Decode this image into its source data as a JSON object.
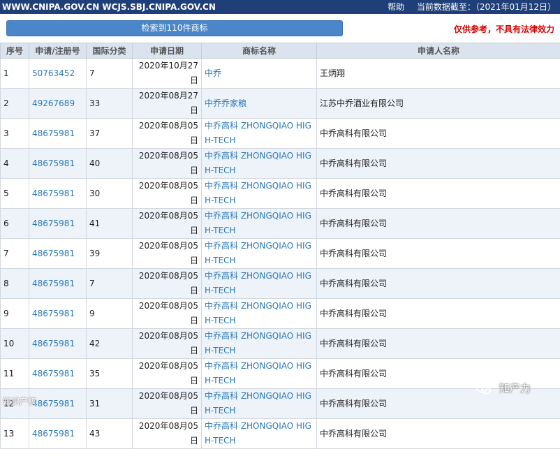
{
  "topbar": {
    "sites": "WWW.CNIPA.GOV.CN WCJS.SBJ.CNIPA.GOV.CN",
    "help": "帮助",
    "data_date": "当前数据截至：（2021年01月12日）"
  },
  "toolbar": {
    "result_label": "检索到110件商标",
    "disclaimer": "仅供参考，不具有法律效力"
  },
  "table": {
    "headers": [
      "序号",
      "申请/注册号",
      "国际分类",
      "申请日期",
      "商标名称",
      "申请人名称"
    ],
    "rows": [
      {
        "no": "1",
        "reg": "50763452",
        "cls": "7",
        "date": "2020年10月27日",
        "mark": "中乔",
        "applicant": "王炳翔"
      },
      {
        "no": "2",
        "reg": "49267689",
        "cls": "33",
        "date": "2020年08月27日",
        "mark": "中乔乔家粮",
        "applicant": "江苏中乔酒业有限公司"
      },
      {
        "no": "3",
        "reg": "48675981",
        "cls": "37",
        "date": "2020年08月05日",
        "mark": "中乔高科 ZHONGQIAO HIGH-TECH",
        "applicant": "中乔高科有限公司"
      },
      {
        "no": "4",
        "reg": "48675981",
        "cls": "40",
        "date": "2020年08月05日",
        "mark": "中乔高科 ZHONGQIAO HIGH-TECH",
        "applicant": "中乔高科有限公司"
      },
      {
        "no": "5",
        "reg": "48675981",
        "cls": "30",
        "date": "2020年08月05日",
        "mark": "中乔高科 ZHONGQIAO HIGH-TECH",
        "applicant": "中乔高科有限公司"
      },
      {
        "no": "6",
        "reg": "48675981",
        "cls": "41",
        "date": "2020年08月05日",
        "mark": "中乔高科 ZHONGQIAO HIGH-TECH",
        "applicant": "中乔高科有限公司"
      },
      {
        "no": "7",
        "reg": "48675981",
        "cls": "39",
        "date": "2020年08月05日",
        "mark": "中乔高科 ZHONGQIAO HIGH-TECH",
        "applicant": "中乔高科有限公司"
      },
      {
        "no": "8",
        "reg": "48675981",
        "cls": "7",
        "date": "2020年08月05日",
        "mark": "中乔高科 ZHONGQIAO HIGH-TECH",
        "applicant": "中乔高科有限公司"
      },
      {
        "no": "9",
        "reg": "48675981",
        "cls": "9",
        "date": "2020年08月05日",
        "mark": "中乔高科 ZHONGQIAO HIGH-TECH",
        "applicant": "中乔高科有限公司"
      },
      {
        "no": "10",
        "reg": "48675981",
        "cls": "42",
        "date": "2020年08月05日",
        "mark": "中乔高科 ZHONGQIAO HIGH-TECH",
        "applicant": "中乔高科有限公司"
      },
      {
        "no": "11",
        "reg": "48675981",
        "cls": "35",
        "date": "2020年08月05日",
        "mark": "中乔高科 ZHONGQIAO HIGH-TECH",
        "applicant": "中乔高科有限公司"
      },
      {
        "no": "12",
        "reg": "48675981",
        "cls": "31",
        "date": "2020年08月05日",
        "mark": "中乔高科 ZHONGQIAO HIGH-TECH",
        "applicant": "中乔高科有限公司"
      },
      {
        "no": "13",
        "reg": "48675981",
        "cls": "43",
        "date": "2020年08月05日",
        "mark": "中乔高科 ZHONGQIAO HIGH-TECH",
        "applicant": "中乔高科有限公司"
      }
    ]
  },
  "watermarks": {
    "left": "知识产权",
    "right": "知产力",
    "right_icon": "wechat-icon"
  }
}
